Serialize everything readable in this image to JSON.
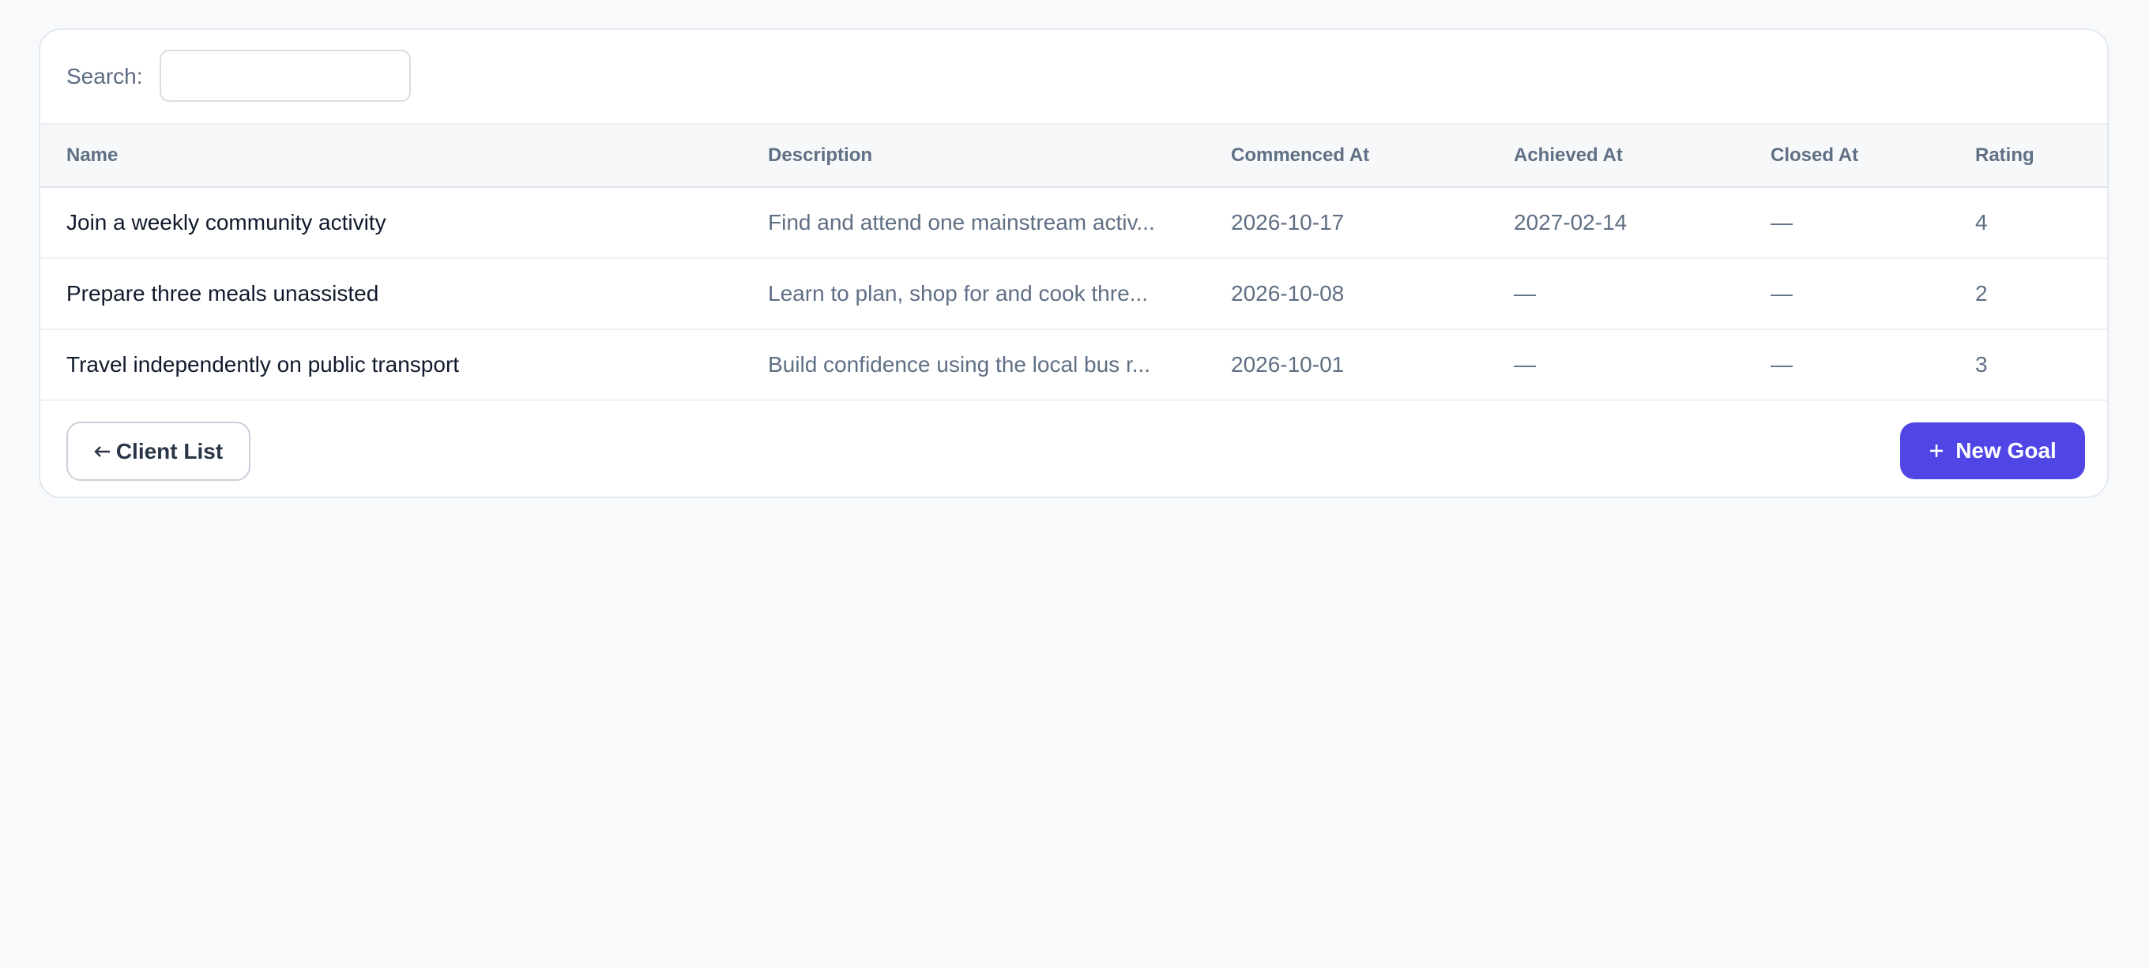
{
  "search": {
    "label": "Search:",
    "value": "",
    "placeholder": ""
  },
  "table": {
    "columns": [
      "Name",
      "Description",
      "Commenced At",
      "Achieved At",
      "Closed At",
      "Rating"
    ],
    "rows": [
      {
        "name": "Join a weekly community activity",
        "description": "Find and attend one mainstream activ...",
        "commenced_at": "2026-10-17",
        "achieved_at": "2027-02-14",
        "closed_at": "—",
        "rating": "4"
      },
      {
        "name": "Prepare three meals unassisted",
        "description": "Learn to plan, shop for and cook thre...",
        "commenced_at": "2026-10-08",
        "achieved_at": "—",
        "closed_at": "—",
        "rating": "2"
      },
      {
        "name": "Travel independently on public transport",
        "description": "Build confidence using the local bus r...",
        "commenced_at": "2026-10-01",
        "achieved_at": "—",
        "closed_at": "—",
        "rating": "3"
      }
    ]
  },
  "footer": {
    "back_icon": "arrow-left-icon",
    "back_label": "Client List",
    "new_icon": "plus-icon",
    "new_label": "New Goal"
  },
  "colors": {
    "accent": "#4f46e5",
    "background": "#f8f9fb"
  }
}
